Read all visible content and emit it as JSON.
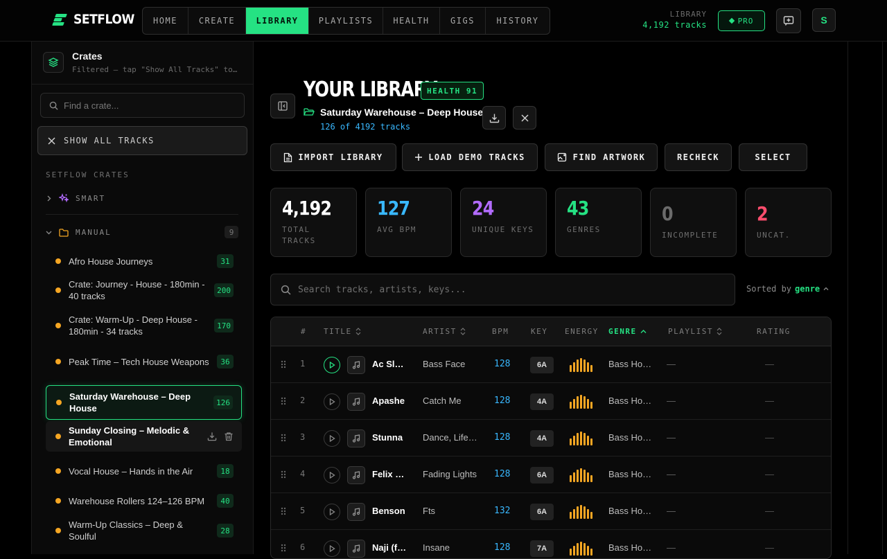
{
  "app": {
    "name": "SETFLOW",
    "accent": "#25e283"
  },
  "nav": {
    "tabs": [
      {
        "label": "HOME",
        "width": 66
      },
      {
        "label": "CREATE",
        "width": 83
      },
      {
        "label": "LIBRARY",
        "width": 91,
        "active": true
      },
      {
        "label": "PLAYLISTS",
        "width": 107
      },
      {
        "label": "HEALTH",
        "width": 82
      },
      {
        "label": "GIGS",
        "width": 66
      },
      {
        "label": "HISTORY",
        "width": 92
      }
    ]
  },
  "header": {
    "library_label": "LIBRARY",
    "library_count": "4,192 tracks",
    "pro_label": "PRO",
    "avatar_letter": "S"
  },
  "sidebar": {
    "title": "Crates",
    "subtitle": "Filtered — tap \"Show All Tracks\" to…",
    "search_placeholder": "Find a crate...",
    "show_all_label": "SHOW ALL TRACKS",
    "section_label": "SETFLOW CRATES",
    "smart_label": "SMART",
    "manual_label": "MANUAL",
    "manual_count": "9",
    "crates": [
      {
        "name": "Afro House Journeys",
        "count": "31"
      },
      {
        "name": "Crate: Journey - House - 180min - 40 tracks",
        "count": "200"
      },
      {
        "name": "Crate: Warm-Up - Deep House - 180min - 34 tracks",
        "count": "170"
      },
      {
        "name": "Peak Time – Tech House Weapons",
        "count": "36"
      },
      {
        "name": "Saturday Warehouse – Deep House",
        "count": "126",
        "state": "active"
      },
      {
        "name": "Sunday Closing – Melodic & Emotional",
        "count": "",
        "state": "hover"
      },
      {
        "name": "Vocal House – Hands in the Air",
        "count": "18"
      },
      {
        "name": "Warehouse Rollers 124–126 BPM",
        "count": "40"
      },
      {
        "name": "Warm-Up Classics – Deep & Soulful",
        "count": "28"
      }
    ]
  },
  "main": {
    "title": "YOUR LIBRARY",
    "health_badge": "HEALTH 91",
    "crate_name": "Saturday Warehouse – Deep House",
    "track_count": "126 of 4192 tracks",
    "actions": [
      {
        "label": "IMPORT LIBRARY",
        "icon": "file-icon"
      },
      {
        "label": "LOAD DEMO TRACKS",
        "icon": "plus-icon"
      },
      {
        "label": "FIND ARTWORK",
        "icon": "image-search-icon"
      },
      {
        "label": "RECHECK",
        "icon": ""
      },
      {
        "label": "SELECT",
        "icon": ""
      }
    ],
    "stats": [
      {
        "value": "4,192",
        "label": "TOTAL TRACKS",
        "color": "#ffffff"
      },
      {
        "value": "127",
        "label": "AVG BPM",
        "color": "#39b8ff"
      },
      {
        "value": "24",
        "label": "UNIQUE KEYS",
        "color": "#b26bff"
      },
      {
        "value": "43",
        "label": "GENRES",
        "color": "#25e283"
      },
      {
        "value": "0",
        "label": "INCOMPLETE",
        "color": "#6b6b6b"
      },
      {
        "value": "2",
        "label": "UNCAT.",
        "color": "#ff4d6d"
      }
    ],
    "search_placeholder": "Search tracks, artists, keys...",
    "sort_prefix": "Sorted by",
    "sort_field": "genre",
    "columns": {
      "num": "#",
      "title": "TITLE",
      "artist": "ARTIST",
      "bpm": "BPM",
      "key": "KEY",
      "energy": "ENERGY",
      "genre": "GENRE",
      "playlist": "PLAYLIST",
      "rating": "RATING"
    },
    "rows": [
      {
        "num": "1",
        "title": "Ac Slowly",
        "artist": "Bass Face",
        "bpm": "128",
        "key": "6A",
        "genre": "Bass House",
        "playlist": "—",
        "rating": "—",
        "playing": true
      },
      {
        "num": "2",
        "title": "Apashe",
        "artist": "Catch Me",
        "bpm": "128",
        "key": "4A",
        "genre": "Bass House",
        "playlist": "—",
        "rating": "—"
      },
      {
        "num": "3",
        "title": "Stunna",
        "artist": "Dance, Life…",
        "bpm": "128",
        "key": "4A",
        "genre": "Bass House",
        "playlist": "—",
        "rating": "—"
      },
      {
        "num": "4",
        "title": "Felix Jaehn",
        "artist": "Fading Lights",
        "bpm": "128",
        "key": "6A",
        "genre": "Bass House",
        "playlist": "—",
        "rating": "—"
      },
      {
        "num": "5",
        "title": "Benson",
        "artist": "Fts",
        "bpm": "132",
        "key": "6A",
        "genre": "Bass House",
        "playlist": "—",
        "rating": "—"
      },
      {
        "num": "6",
        "title": "Naji (feat)",
        "artist": "Insane",
        "bpm": "128",
        "key": "7A",
        "genre": "Bass House",
        "playlist": "—",
        "rating": "—"
      }
    ]
  }
}
